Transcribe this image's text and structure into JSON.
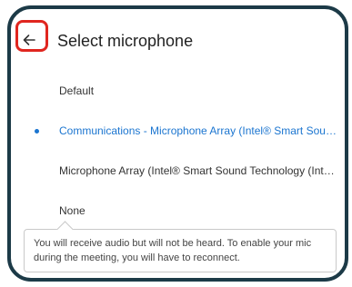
{
  "header": {
    "title": "Select microphone",
    "back_icon": "arrow-left-icon"
  },
  "colors": {
    "frame_border": "#1c3a47",
    "highlight_box": "#e0261f",
    "selected_option": "#1b75d0"
  },
  "options": [
    {
      "label": "Default",
      "selected": false
    },
    {
      "label": "Communications - Microphone Array (Intel® Smart Sound...",
      "selected": true
    },
    {
      "label": "Microphone Array (Intel® Smart Sound Technology (Intel® ...",
      "selected": false
    },
    {
      "label": "None",
      "selected": false
    }
  ],
  "tooltip": {
    "text": "You will receive audio but will not be heard. To enable your mic during the meeting, you will have to reconnect."
  }
}
